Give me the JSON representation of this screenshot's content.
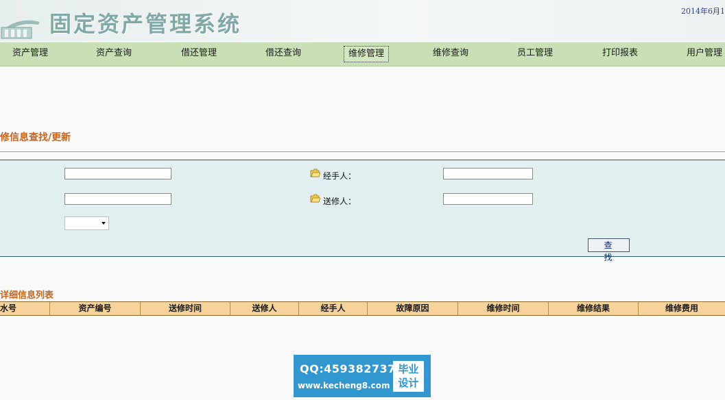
{
  "header": {
    "title": "固定资产管理系统",
    "date": "2014年6月1"
  },
  "nav": {
    "items": [
      {
        "label": "资产管理"
      },
      {
        "label": "资产查询"
      },
      {
        "label": "借还管理"
      },
      {
        "label": "借还查询"
      },
      {
        "label": "维修管理",
        "active": true
      },
      {
        "label": "维修查询"
      },
      {
        "label": "员工管理"
      },
      {
        "label": "打印报表"
      },
      {
        "label": "用户管理"
      }
    ]
  },
  "search": {
    "section_title": "修信息查找/更新",
    "handler_label": "经手人：",
    "sender_label": "送修人：",
    "field1_value": "",
    "field2_value": "",
    "handler_value": "",
    "sender_value": "",
    "status_selected": "",
    "button_label": "查 找"
  },
  "list": {
    "title": "详细信息列表",
    "columns": [
      "水号",
      "资产编号",
      "送修时间",
      "送修人",
      "经手人",
      "故障原因",
      "维修时间",
      "维修结果",
      "维修费用"
    ]
  },
  "watermark": {
    "qq": "QQ:459382737",
    "url": "www.kecheng8.com",
    "badge_line1": "毕业",
    "badge_line2": "设计"
  },
  "colors": {
    "nav_bg": "#c9e0b6",
    "panel_bg": "#e1eff0",
    "accent_orange": "#c8651c",
    "table_header_bg": "#f7d39b",
    "watermark_bg": "#3296cf"
  },
  "icons": {
    "logo": "building-logo-icon",
    "field_marker": "folder-icon"
  }
}
